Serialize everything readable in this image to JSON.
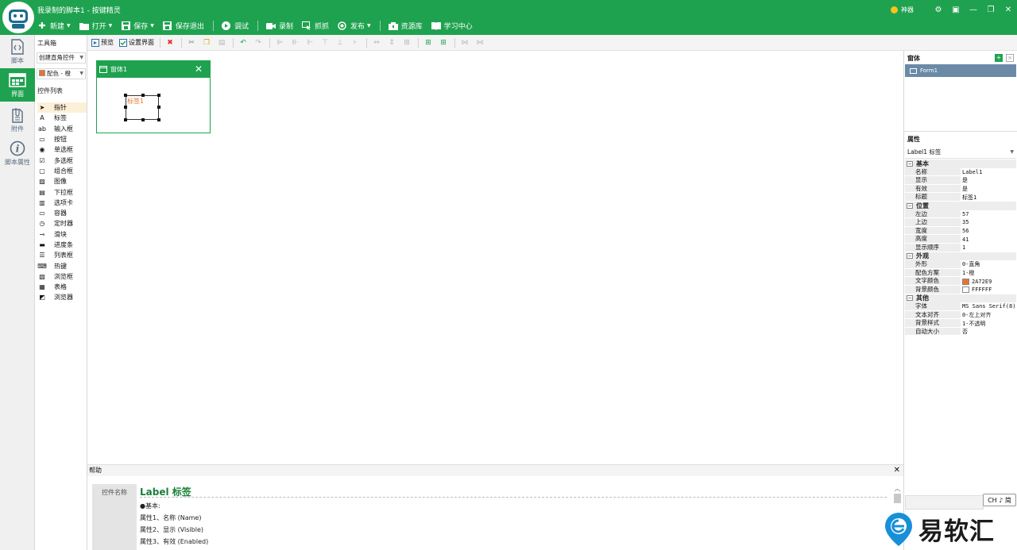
{
  "window": {
    "title": "我录制的脚本1 - 按键精灵",
    "tips_label": "神器",
    "controls": [
      "⚙",
      "▣",
      "—",
      "❐",
      "✕"
    ]
  },
  "menu": [
    {
      "label": "新建",
      "icon": "plus-icon",
      "dropdown": true
    },
    {
      "label": "打开",
      "icon": "folder-icon",
      "dropdown": true
    },
    {
      "label": "保存",
      "icon": "save-icon",
      "dropdown": true
    },
    {
      "label": "保存退出",
      "icon": "save-exit-icon",
      "dropdown": false
    },
    {
      "label": "调试",
      "icon": "play-icon",
      "dropdown": false
    },
    {
      "label": "录制",
      "icon": "record-icon",
      "dropdown": false
    },
    {
      "label": "抓抓",
      "icon": "capture-icon",
      "dropdown": false
    },
    {
      "label": "发布",
      "icon": "publish-icon",
      "dropdown": true
    },
    {
      "label": "资源库",
      "icon": "resource-icon",
      "dropdown": false
    },
    {
      "label": "学习中心",
      "icon": "learning-icon",
      "dropdown": false
    }
  ],
  "rail": [
    {
      "label": "脚本",
      "icon": "script-icon",
      "active": false
    },
    {
      "label": "界面",
      "icon": "interface-icon",
      "active": true
    },
    {
      "label": "附件",
      "icon": "attachment-icon",
      "active": false
    },
    {
      "label": "脚本属性",
      "icon": "info-icon",
      "active": false
    }
  ],
  "toolbox": {
    "title": "工具箱",
    "shape_select": "创建直角控件",
    "color_select": "配色 - 橙",
    "list_title": "控件列表",
    "controls": [
      {
        "label": "指针",
        "icon": "pointer-icon",
        "glyph": "➤"
      },
      {
        "label": "标签",
        "icon": "label-icon",
        "glyph": "A"
      },
      {
        "label": "输入框",
        "icon": "textbox-icon",
        "glyph": "ab"
      },
      {
        "label": "按钮",
        "icon": "button-icon",
        "glyph": "▭"
      },
      {
        "label": "单选框",
        "icon": "radio-icon",
        "glyph": "◉"
      },
      {
        "label": "多选框",
        "icon": "checkbox-icon",
        "glyph": "☑"
      },
      {
        "label": "组合框",
        "icon": "groupbox-icon",
        "glyph": "▢"
      },
      {
        "label": "图像",
        "icon": "image-icon",
        "glyph": "▨"
      },
      {
        "label": "下拉框",
        "icon": "dropdown-icon",
        "glyph": "▤"
      },
      {
        "label": "选项卡",
        "icon": "tab-icon",
        "glyph": "▥"
      },
      {
        "label": "容器",
        "icon": "container-icon",
        "glyph": "▭"
      },
      {
        "label": "定时器",
        "icon": "timer-icon",
        "glyph": "◷"
      },
      {
        "label": "滑块",
        "icon": "slider-icon",
        "glyph": "⊸"
      },
      {
        "label": "进度条",
        "icon": "progress-icon",
        "glyph": "▬"
      },
      {
        "label": "列表框",
        "icon": "listbox-icon",
        "glyph": "☰"
      },
      {
        "label": "热键",
        "icon": "hotkey-icon",
        "glyph": "⌨"
      },
      {
        "label": "浏览框",
        "icon": "browsebox-icon",
        "glyph": "▧"
      },
      {
        "label": "表格",
        "icon": "grid-icon",
        "glyph": "▦"
      },
      {
        "label": "浏览器",
        "icon": "browser-icon",
        "glyph": "◩"
      }
    ]
  },
  "toolbar2": {
    "preview": "预览",
    "set_interface": "设置界面"
  },
  "form": {
    "title": "窗体1",
    "label_text": "标签1"
  },
  "windows_panel": {
    "title": "窗体",
    "items": [
      "Form1"
    ]
  },
  "properties": {
    "title": "属性",
    "object": "Label1 标签",
    "groups": [
      {
        "name": "基本",
        "rows": [
          {
            "k": "名称",
            "v": "Label1"
          },
          {
            "k": "显示",
            "v": "是"
          },
          {
            "k": "有效",
            "v": "是"
          },
          {
            "k": "标题",
            "v": "标签1"
          }
        ]
      },
      {
        "name": "位置",
        "rows": [
          {
            "k": "左边",
            "v": "57"
          },
          {
            "k": "上边",
            "v": "35"
          },
          {
            "k": "宽度",
            "v": "56"
          },
          {
            "k": "高度",
            "v": "41"
          },
          {
            "k": "显示顺序",
            "v": "1"
          }
        ]
      },
      {
        "name": "外观",
        "rows": [
          {
            "k": "外形",
            "v": "0-直角"
          },
          {
            "k": "配色方案",
            "v": "1-橙"
          },
          {
            "k": "文字颜色",
            "v": "2A72E9",
            "swatch": "#e8742b"
          },
          {
            "k": "背景颜色",
            "v": "FFFFFF",
            "swatch": "#ffffff"
          }
        ]
      },
      {
        "name": "其他",
        "rows": [
          {
            "k": "字体",
            "v": "MS Sans Serif(8)"
          },
          {
            "k": "文本对齐",
            "v": "0-左上对齐"
          },
          {
            "k": "背景样式",
            "v": "1-不透明"
          },
          {
            "k": "自动大小",
            "v": "否"
          }
        ]
      }
    ]
  },
  "help": {
    "header": "帮助",
    "name_label": "控件名称",
    "title": "Label 标签",
    "lines": [
      "●基本:",
      "属性1、名称 (Name)",
      "属性2、显示 (Visible)",
      "属性3、有效 (Enabled)"
    ]
  },
  "ime": "CH ♪ 简",
  "watermark": "易软汇",
  "colors": {
    "brand": "#1fa24f",
    "accent": "#e8742b",
    "selection": "#6b8aa8"
  }
}
